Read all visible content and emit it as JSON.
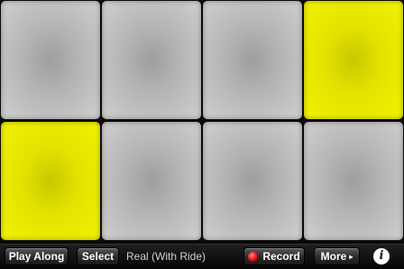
{
  "pads": [
    {
      "id": 1,
      "active": false
    },
    {
      "id": 2,
      "active": false
    },
    {
      "id": 3,
      "active": false
    },
    {
      "id": 4,
      "active": true
    },
    {
      "id": 5,
      "active": true
    },
    {
      "id": 6,
      "active": false
    },
    {
      "id": 7,
      "active": false
    },
    {
      "id": 8,
      "active": false
    }
  ],
  "colors": {
    "pad_idle": "#c0c0c0",
    "pad_active": "#e6e600",
    "record": "#e10000"
  },
  "toolbar": {
    "play_along_label": "Play Along",
    "select_label": "Select",
    "kit_name": "Real (With Ride)",
    "record_label": "Record",
    "more_label": "More",
    "more_arrow": "▸",
    "info_label": "i"
  },
  "icons": {
    "record": "record-dot-icon",
    "more": "play-arrow-icon",
    "info": "info-icon"
  }
}
